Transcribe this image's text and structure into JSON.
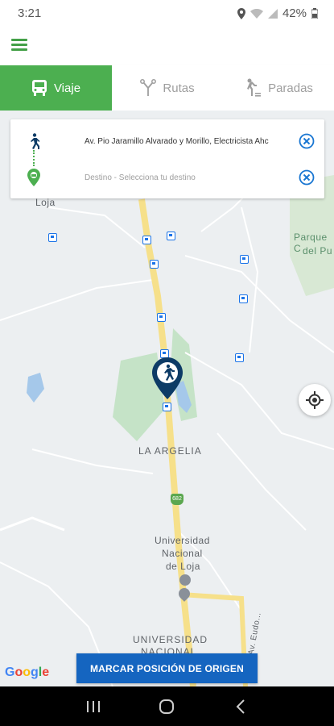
{
  "status": {
    "time": "3:21",
    "battery": "42%"
  },
  "tabs": [
    {
      "label": "Viaje",
      "icon": "bus-icon",
      "active": true
    },
    {
      "label": "Rutas",
      "icon": "routes-icon",
      "active": false
    },
    {
      "label": "Paradas",
      "icon": "stops-icon",
      "active": false
    }
  ],
  "search": {
    "origin": "Av. Pio Jaramillo Alvarado y Morillo, Electricista Ahc",
    "destination_placeholder": "Destino - Selecciona tu destino"
  },
  "map": {
    "labels": {
      "loja": "Loja",
      "parque": "Parque C",
      "parque2": "del Pu",
      "argelia": "LA ARGELIA",
      "route_badge": "682",
      "universidad1": "Universidad",
      "universidad2": "Nacional",
      "universidad3": "de Loja",
      "univ_caps1": "UNIVERSIDAD",
      "univ_caps2": "NACIONAL",
      "road": "Av. Eudo..."
    },
    "google": "Google"
  },
  "cta": {
    "label": "MARCAR POSICIÓN DE ORIGEN"
  },
  "colors": {
    "primary": "#4caf50",
    "accent": "#1565c0",
    "marker": "#0d3b66"
  }
}
